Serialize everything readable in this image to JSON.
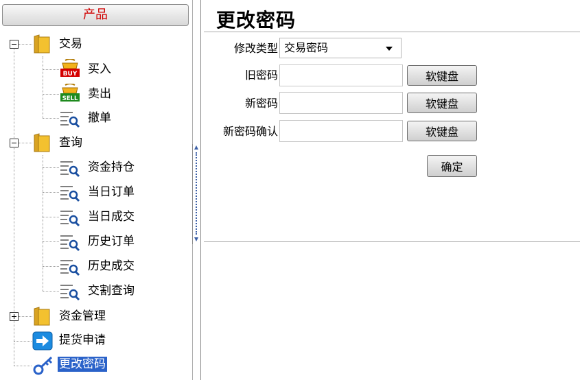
{
  "sidebar": {
    "header": "产品",
    "nodes": {
      "trade": {
        "label": "交易",
        "children": {
          "buy": "买入",
          "sell": "卖出",
          "cancel": "撤单"
        },
        "icon_badges": {
          "buy": "BUY",
          "sell": "SELL"
        }
      },
      "query": {
        "label": "查询",
        "children": [
          "资金持仓",
          "当日订单",
          "当日成交",
          "历史订单",
          "历史成交",
          "交割查询"
        ]
      },
      "funds": {
        "label": "资金管理"
      },
      "delivery": {
        "label": "提货申请"
      },
      "password": {
        "label": "更改密码",
        "selected": true
      }
    },
    "icons": {
      "folder": "folder-icon",
      "buy": "buy-basket-icon",
      "sell": "sell-basket-icon",
      "search": "list-search-icon",
      "arrow": "arrow-right-icon",
      "key": "key-icon"
    }
  },
  "main": {
    "title": "更改密码",
    "form": {
      "type_label": "修改类型",
      "type_value": "交易密码",
      "old_label": "旧密码",
      "new_label": "新密码",
      "confirm_label": "新密码确认",
      "keyboard_label": "软键盘",
      "submit_label": "确定"
    }
  },
  "colors": {
    "header_text": "#d00000",
    "selected_bg": "#2a62c9",
    "buy_badge": "#d40000",
    "sell_badge": "#1e8a1e",
    "folder": "#f3c12f"
  }
}
